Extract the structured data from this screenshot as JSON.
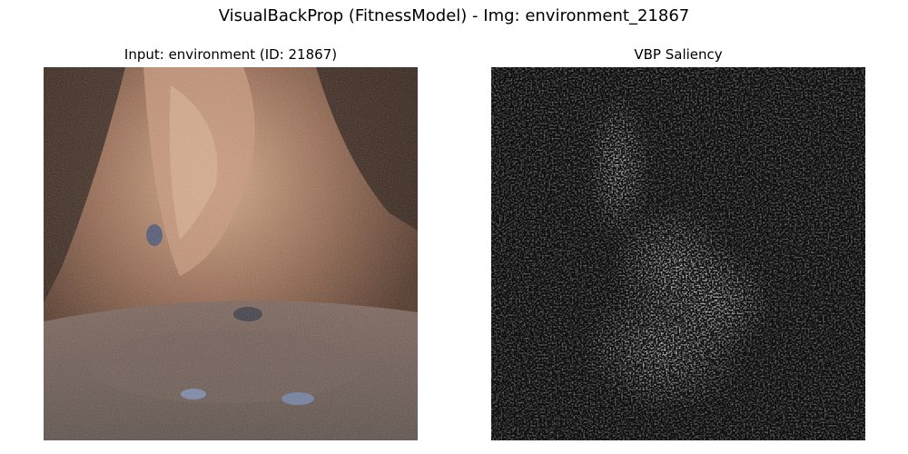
{
  "figure": {
    "suptitle": "VisualBackProp (FitnessModel) - Img: environment_21867"
  },
  "panels": [
    {
      "title": "Input: environment (ID: 21867)",
      "content": "cave rock photograph"
    },
    {
      "title": "VBP Saliency",
      "content": "grayscale saliency map"
    }
  ],
  "colors": {
    "rock_light": "#c89a7a",
    "rock_mid": "#8a5a44",
    "rock_dark": "#3a2418",
    "floor": "#6e5e55",
    "saliency_bg": "#0c0c0c",
    "saliency_hot": "#ffffff"
  }
}
